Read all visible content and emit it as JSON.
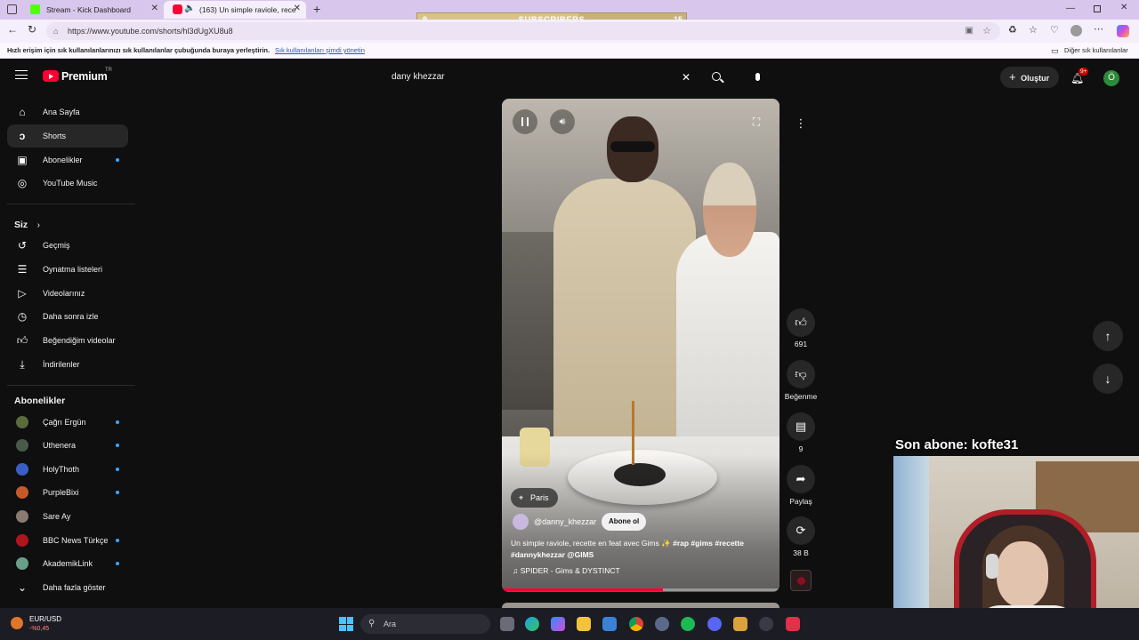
{
  "browser": {
    "tabs": [
      {
        "label": "Stream - Kick Dashboard",
        "active": false
      },
      {
        "label": "(163) Un simple raviole, rece",
        "active": true
      }
    ],
    "url": "https://www.youtube.com/shorts/hl3dUgXU8u8",
    "bookmarks_hint": "Hızlı erişim için sık kullanılanlarınızı sık kullanılanlar çubuğunda buraya yerleştirin.",
    "bookmarks_link": "Sık kullanılanları şimdi yönetin",
    "other_bookmarks": "Diğer sık kullanılanlar"
  },
  "overlay": {
    "subs_left": "9",
    "subs_label": "SUBSCRIBERS",
    "subs_right": "15",
    "last_sub": "Son abone: kofte31"
  },
  "youtube": {
    "logo": "Premium",
    "logo_sup": "TR",
    "search_value": "dany khezzar",
    "create_label": "Oluştur",
    "notif_badge": "9+",
    "avatar_letter": "Ö",
    "sidebar": {
      "main": [
        {
          "label": "Ana Sayfa",
          "icon": "home-icon"
        },
        {
          "label": "Shorts",
          "icon": "shorts-icon"
        },
        {
          "label": "Abonelikler",
          "icon": "subscriptions-icon"
        },
        {
          "label": "YouTube Music",
          "icon": "music-icon"
        }
      ],
      "you_heading": "Siz",
      "you": [
        {
          "label": "Geçmiş",
          "icon": "history-icon"
        },
        {
          "label": "Oynatma listeleri",
          "icon": "playlist-icon"
        },
        {
          "label": "Videolarınız",
          "icon": "video-icon"
        },
        {
          "label": "Daha sonra izle",
          "icon": "clock-icon"
        },
        {
          "label": "Beğendiğim videolar",
          "icon": "like-icon"
        },
        {
          "label": "İndirilenler",
          "icon": "download-icon"
        }
      ],
      "subs_heading": "Abonelikler",
      "subs": [
        {
          "label": "Çağrı Ergün",
          "color": "#5a6b3c"
        },
        {
          "label": "Uthenera",
          "color": "#4a5a48"
        },
        {
          "label": "HolyThoth",
          "color": "#3a5fc4"
        },
        {
          "label": "PurpleBixi",
          "color": "#c45a2c"
        },
        {
          "label": "Sare Ay",
          "color": "#8a7a70"
        },
        {
          "label": "BBC News Türkçe",
          "color": "#b0151e"
        },
        {
          "label": "AkademikLink",
          "color": "#6aa08a"
        }
      ],
      "more_label": "Daha fazla göster"
    },
    "short": {
      "location": "Paris",
      "channel": "@danny_khezzar",
      "subscribe": "Abone ol",
      "title_line1": "Un simple raviole, recette en feat avec Gims",
      "hashtags_line1": "#rap #gims #recette",
      "title_line2": "#dannykhezzar @GIMS",
      "music": "SPIDER - Gims & DYSTINCT",
      "progress": 0.58
    },
    "actions": {
      "likes": "691",
      "dislike": "Beğenme",
      "comments": "9",
      "share": "Paylaş",
      "remix": "38 B"
    }
  },
  "taskbar": {
    "search": "Ara",
    "ticker_name": "EUR/USD",
    "ticker_change": "-%0,45"
  },
  "colors": {
    "brand_red": "#ff0033",
    "tab_bar": "#d9c6ec",
    "accent_blue": "#3ea6ff"
  }
}
